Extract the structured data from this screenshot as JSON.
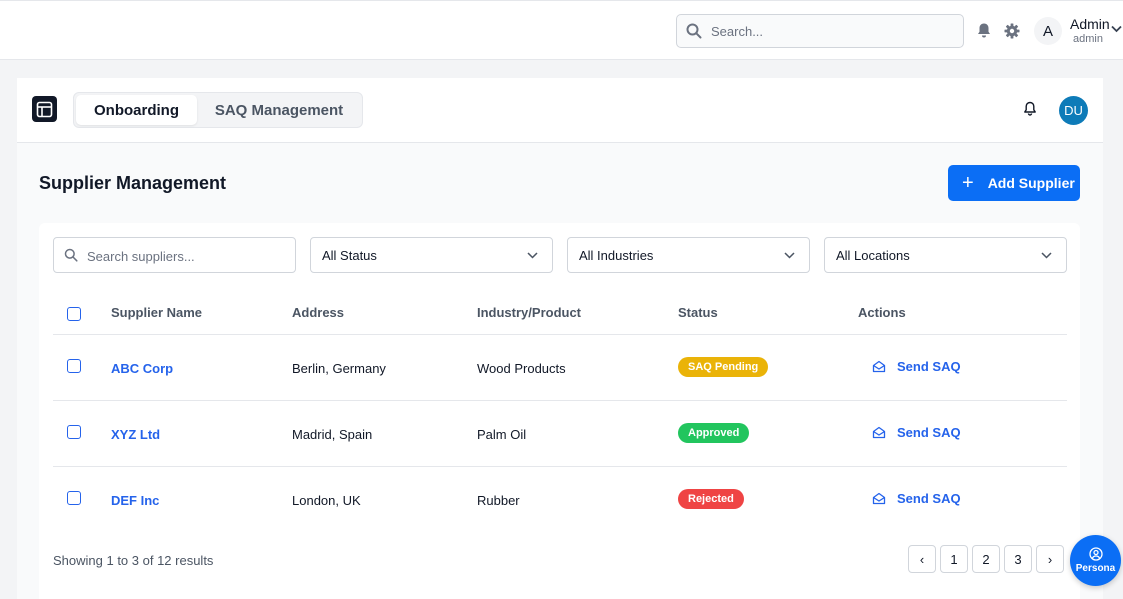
{
  "topbar": {
    "search_placeholder": "Search...",
    "user": {
      "initial": "A",
      "name": "Admin",
      "role": "admin"
    }
  },
  "app": {
    "tabs": [
      {
        "label": "Onboarding",
        "active": true
      },
      {
        "label": "SAQ Management",
        "active": false
      }
    ],
    "user_initials": "DU"
  },
  "page": {
    "title": "Supplier Management",
    "add_button": "Add Supplier"
  },
  "filters": {
    "search_placeholder": "Search suppliers...",
    "status": "All Status",
    "industries": "All Industries",
    "locations": "All Locations"
  },
  "table": {
    "columns": [
      "Supplier Name",
      "Address",
      "Industry/Product",
      "Status",
      "Actions"
    ],
    "rows": [
      {
        "name": "ABC Corp",
        "address": "Berlin, Germany",
        "industry": "Wood Products",
        "status": "SAQ Pending",
        "status_color": "#eab308",
        "action": "Send SAQ"
      },
      {
        "name": "XYZ Ltd",
        "address": "Madrid, Spain",
        "industry": "Palm Oil",
        "status": "Approved",
        "status_color": "#22c55e",
        "action": "Send SAQ"
      },
      {
        "name": "DEF Inc",
        "address": "London, UK",
        "industry": "Rubber",
        "status": "Rejected",
        "status_color": "#ef4444",
        "action": "Send SAQ"
      }
    ]
  },
  "pagination": {
    "summary": "Showing 1 to 3 of 12 results",
    "pages": [
      "1",
      "2",
      "3"
    ],
    "prev": "‹",
    "next": "›"
  },
  "persona_button": "Persona",
  "colors": {
    "primary": "#0b6ef5",
    "avatar": "#0e7bb8",
    "link": "#2563eb"
  }
}
